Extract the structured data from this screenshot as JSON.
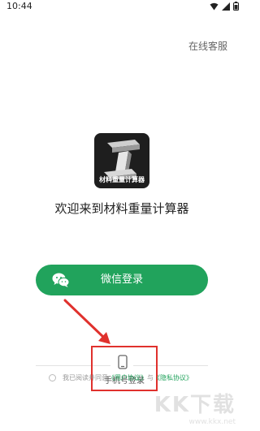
{
  "status_bar": {
    "time": "10:44"
  },
  "header": {
    "online_service": "在线客服"
  },
  "logo": {
    "text": "材料重量计算器"
  },
  "welcome_text": "欢迎来到材料重量计算器",
  "wechat_login": {
    "label": "微信登录"
  },
  "phone_login": {
    "label": "手机号登录"
  },
  "agreement": {
    "prefix": "我已阅读并同意",
    "user_agreement": "《用户协议》",
    "conjunction": "与",
    "privacy_policy": "《隐私协议》"
  },
  "watermark": {
    "text": "KK下载",
    "url": "www.kkx.net"
  },
  "colors": {
    "accent": "#21a35c",
    "highlight": "#e0312d",
    "logo_bg": "#1e1e1e"
  },
  "icons": [
    "wifi-icon",
    "signal-icon",
    "battery-icon",
    "wechat-icon",
    "phone-icon",
    "checkbox-icon"
  ]
}
